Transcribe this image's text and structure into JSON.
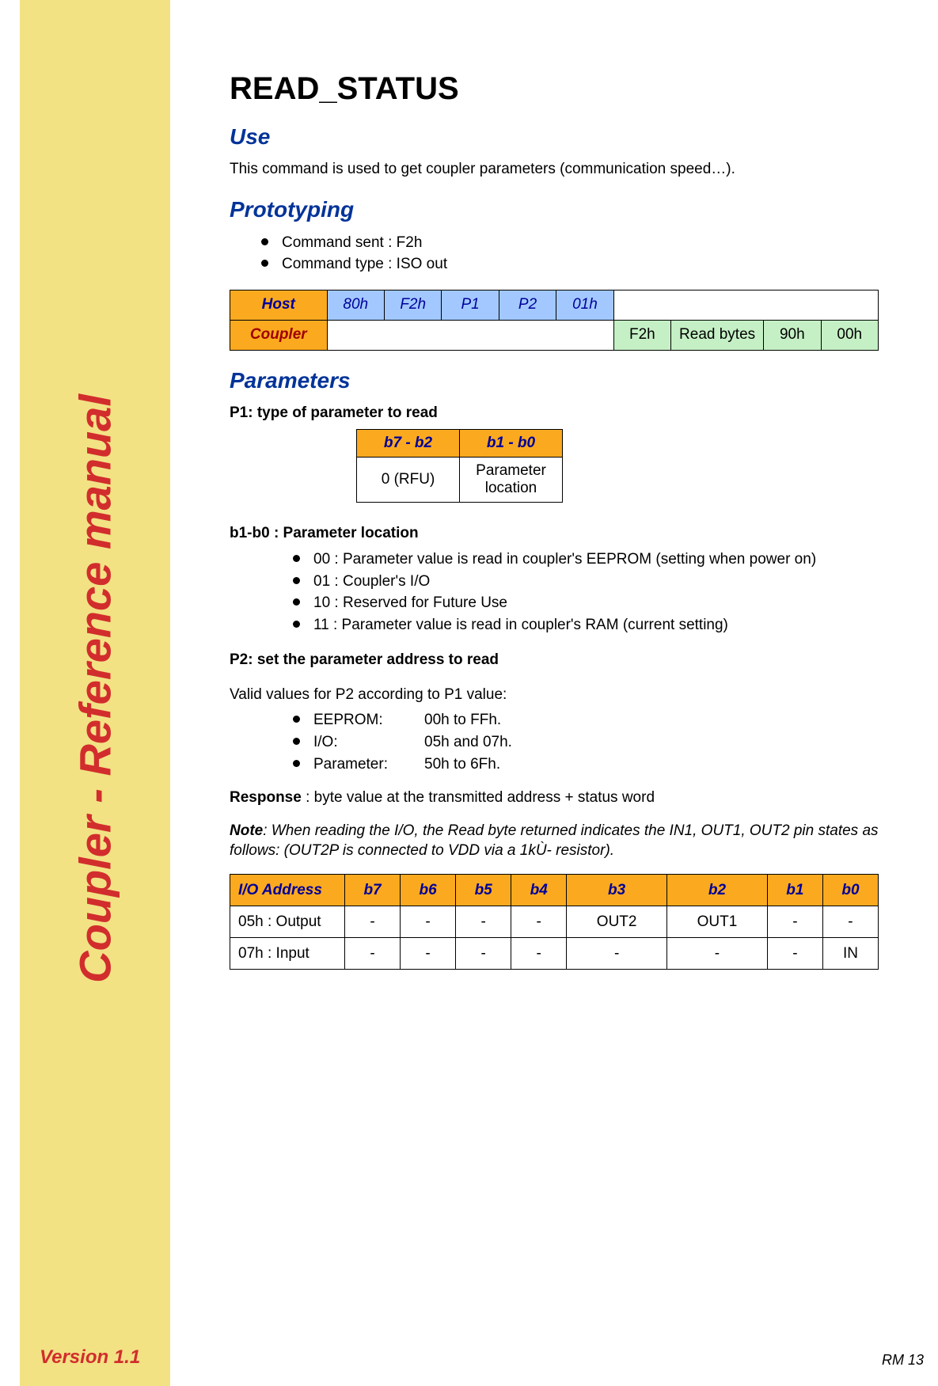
{
  "sidebar": {
    "title": "Coupler - Reference manual",
    "version": "Version 1.1"
  },
  "page_no": "RM 13",
  "heading": "READ_STATUS",
  "sections": {
    "use": {
      "title": "Use",
      "text": "This command is used to get coupler parameters (communication speed…)."
    },
    "prototyping": {
      "title": "Prototyping",
      "bullets": [
        "Command sent : F2h",
        "Command type : ISO out"
      ],
      "table": {
        "host_label": "Host",
        "host_cells": [
          "80h",
          "F2h",
          "P1",
          "P2",
          "01h"
        ],
        "coupler_label": "Coupler",
        "coupler_cells": [
          "F2h",
          "Read bytes",
          "90h",
          "00h"
        ]
      }
    },
    "parameters": {
      "title": "Parameters",
      "p1_heading": "P1: type of parameter to read",
      "p1_table": {
        "hdr": [
          "b7 - b2",
          "b1 - b0"
        ],
        "row": [
          "0 (RFU)",
          "Parameter location"
        ]
      },
      "b1b0_heading": "b1-b0 : Parameter location",
      "b1b0_bullets": [
        "00 : Parameter value is read in coupler's EEPROM (setting when power on)",
        "01 : Coupler's I/O",
        "10 : Reserved for Future Use",
        "11 : Parameter value is read in coupler's RAM (current setting)"
      ],
      "p2_heading": "P2: set the parameter address to read",
      "p2_intro": "Valid values for P2 according to P1 value:",
      "p2_bullets": [
        {
          "key": "EEPROM:",
          "val": "00h to FFh."
        },
        {
          "key": "I/O:",
          "val": "05h and 07h."
        },
        {
          "key": "Parameter:",
          "val": "50h to 6Fh."
        }
      ],
      "response_label": "Response",
      "response_text": " : byte value at the transmitted address + status word",
      "note_label": "Note",
      "note_text": ":  When reading the I/O, the Read byte returned indicates the IN1, OUT1, OUT2 pin states as follows: (OUT2P is connected to VDD via a 1kÙ- resistor).",
      "io_table": {
        "hdr": [
          "I/O Address",
          "b7",
          "b6",
          "b5",
          "b4",
          "b3",
          "b2",
          "b1",
          "b0"
        ],
        "rows": [
          [
            "05h : Output",
            "-",
            "-",
            "-",
            "-",
            "OUT2",
            "OUT1",
            "-",
            "-"
          ],
          [
            "07h : Input",
            "-",
            "-",
            "-",
            "-",
            "-",
            "-",
            "-",
            "IN"
          ]
        ]
      }
    }
  }
}
